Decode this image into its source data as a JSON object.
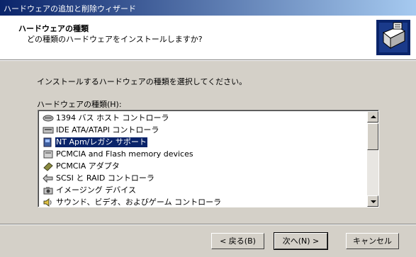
{
  "window": {
    "title": "ハードウェアの追加と削除ウィザード"
  },
  "header": {
    "title": "ハードウェアの種類",
    "subtitle": "どの種類のハードウェアをインストールしますか?",
    "icon": "hardware-wizard-icon"
  },
  "body": {
    "instruction": "インストールするハードウェアの種類を選択してください。",
    "list_label": "ハードウェアの種類(H):"
  },
  "list": {
    "selected_index": 2,
    "items": [
      {
        "label": "1394 バス ホスト コントローラ",
        "icon": "1394-controller-icon"
      },
      {
        "label": "IDE ATA/ATAPI コントローラ",
        "icon": "ide-controller-icon"
      },
      {
        "label": "NT Apm/レガシ サポート",
        "icon": "apm-legacy-icon"
      },
      {
        "label": "PCMCIA and Flash memory devices",
        "icon": "pcmcia-flash-icon"
      },
      {
        "label": "PCMCIA アダプタ",
        "icon": "pcmcia-adapter-icon"
      },
      {
        "label": "SCSI と RAID コントローラ",
        "icon": "scsi-raid-icon"
      },
      {
        "label": "イメージング デバイス",
        "icon": "imaging-device-icon"
      },
      {
        "label": "サウンド、ビデオ、およびゲーム コントローラ",
        "icon": "sound-video-game-icon"
      }
    ]
  },
  "buttons": {
    "back": "< 戻る(B)",
    "next": "次へ(N) >",
    "cancel": "キャンセル"
  },
  "colors": {
    "titlebar": "#0a246a",
    "selection": "#0a246a",
    "face": "#d4d0c8"
  }
}
